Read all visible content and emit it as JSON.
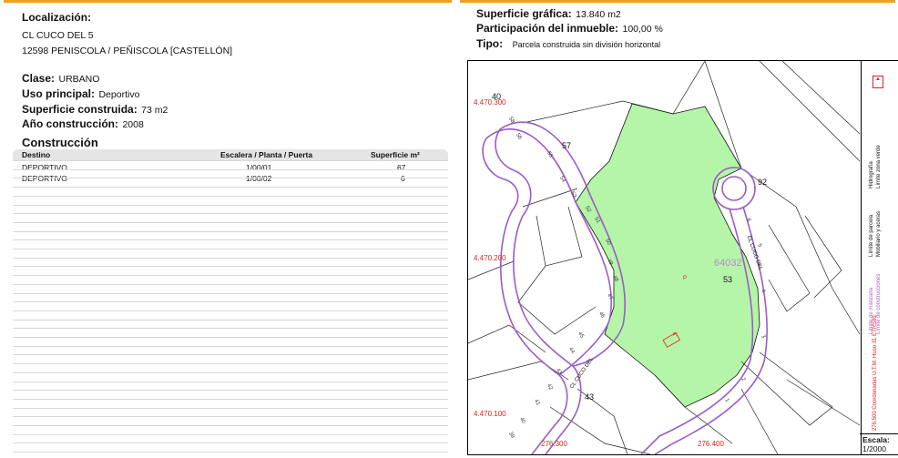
{
  "colors": {
    "accent": "#f0a020",
    "parcel_fill": "#b5f5a8",
    "road": "#9a5cc8",
    "coord_red": "#e02020"
  },
  "left": {
    "loc_label": "Localización:",
    "address_line1": "CL CUCO DEL 5",
    "address_line2": "12598 PENISCOLA / PEÑISCOLA [CASTELLÓN]",
    "clase_label": "Clase:",
    "clase_value": "URBANO",
    "uso_label": "Uso principal:",
    "uso_value": "Deportivo",
    "sup_label": "Superficie construida:",
    "sup_value": "73 m2",
    "anio_label": "Año construcción:",
    "anio_value": "2008",
    "construccion_title": "Construcción",
    "table": {
      "headers": [
        "Destino",
        "Escalera / Planta / Puerta",
        "Superficie m²"
      ],
      "rows": [
        [
          "DEPORTIVO",
          "1/00/01",
          "67"
        ],
        [
          "DEPORTIVO",
          "1/00/02",
          "6"
        ]
      ]
    }
  },
  "right": {
    "sup_grafica_label": "Superficie gráfica:",
    "sup_grafica_value": "13.840 m2",
    "participacion_label": "Participación del inmueble:",
    "participacion_value": "100,00 %",
    "tipo_label": "Tipo:",
    "tipo_value": "Parcela construida sin división horizontal"
  },
  "map": {
    "coords_y": [
      "4.470.300",
      "4.470.200",
      "4.470.100"
    ],
    "coords_x": [
      "276.300",
      "276.400"
    ],
    "parcel_ref": "64032",
    "parcel_labels": [
      "40",
      "57",
      "92",
      "53",
      "43"
    ],
    "street_labels": [
      "CL CUCO DEL",
      "CL CUCO DEL"
    ],
    "numbers_street1": [
      "58",
      "56",
      "55",
      "54",
      "53",
      "52",
      "51",
      "50",
      "49",
      "48",
      "47",
      "46",
      "45",
      "44",
      "43",
      "42",
      "41",
      "40",
      "39"
    ],
    "numbers_street2": [
      "6",
      "5",
      "4",
      "3",
      "2",
      "1"
    ],
    "p_mark": "P",
    "pi_mark": "PI"
  },
  "legend": {
    "items": [
      "Límite de manzana",
      "Límite de construcciones",
      "Límite de parcela",
      "Mobiliario y aceras",
      "Hidrografía",
      "Límite zona verde"
    ],
    "coord_note": "276.500 Coordenadas U.T.M. Huso 31 ETRS89",
    "scale_label": "Escala:",
    "scale_value": "1/2000"
  }
}
